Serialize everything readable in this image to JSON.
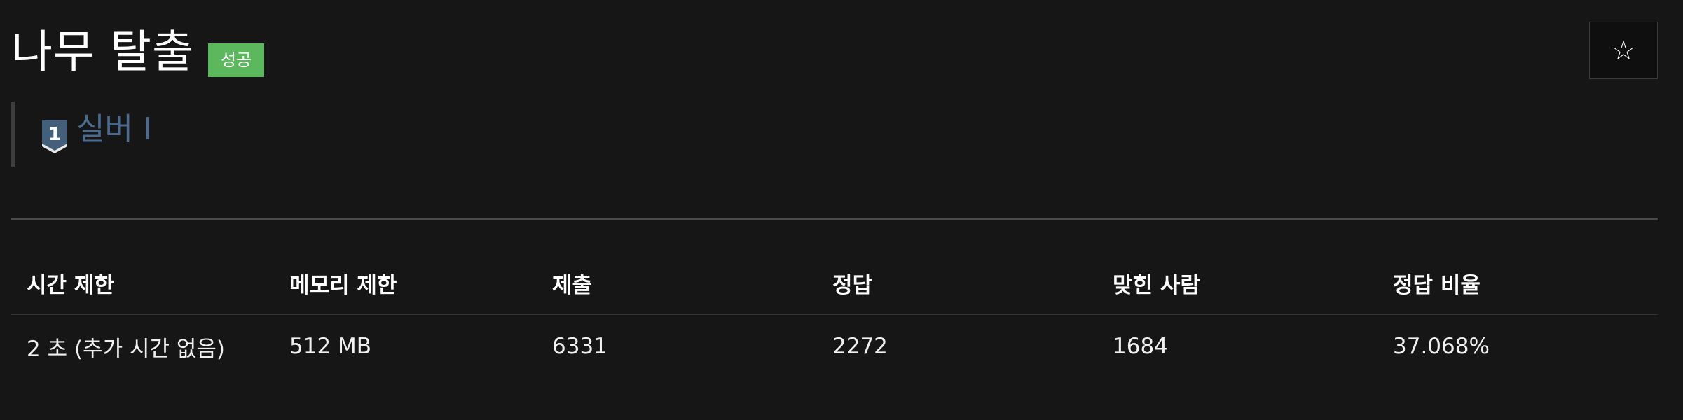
{
  "problem": {
    "title": "나무 탈출",
    "status_badge": "성공",
    "status_color": "#5cb85c"
  },
  "favorite": {
    "icon": "star-outline-icon",
    "glyph": "☆"
  },
  "tier": {
    "icon": "silver-tier-icon",
    "number": "1",
    "label": "실버 I",
    "color": "#4a6b8f"
  },
  "stats": {
    "headers": [
      "시간 제한",
      "메모리 제한",
      "제출",
      "정답",
      "맞힌 사람",
      "정답 비율"
    ],
    "values": [
      "2 초 (추가 시간 없음)",
      "512 MB",
      "6331",
      "2272",
      "1684",
      "37.068%"
    ]
  }
}
